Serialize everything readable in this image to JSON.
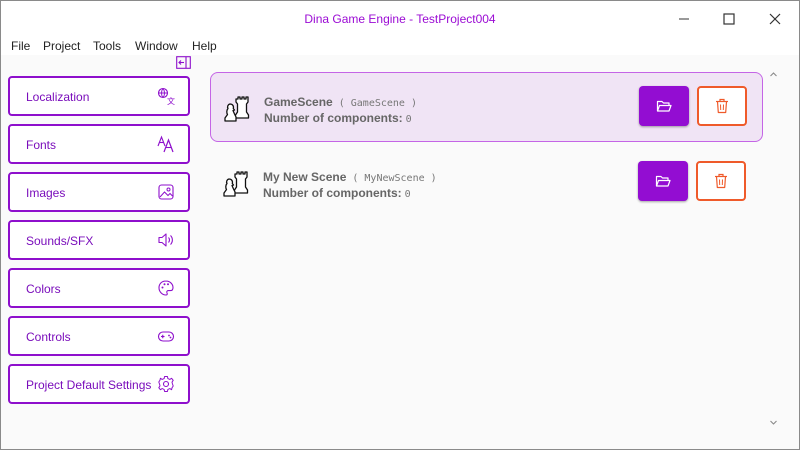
{
  "window": {
    "title": "Dina Game Engine - TestProject004"
  },
  "menu": [
    "File",
    "Project",
    "Tools",
    "Window",
    "Help"
  ],
  "sidebar": {
    "items": [
      {
        "label": "Localization",
        "icon": "translate-icon"
      },
      {
        "label": "Fonts",
        "icon": "font-size-icon"
      },
      {
        "label": "Images",
        "icon": "image-icon"
      },
      {
        "label": "Sounds/SFX",
        "icon": "speaker-icon"
      },
      {
        "label": "Colors",
        "icon": "palette-icon"
      },
      {
        "label": "Controls",
        "icon": "gamepad-icon"
      },
      {
        "label": "Project Default Settings",
        "icon": "gear-icon"
      }
    ]
  },
  "scenes": [
    {
      "name": "GameScene",
      "id": "( GameScene )",
      "components_label": "Number of components:",
      "components": "0",
      "selected": true
    },
    {
      "name": "My New Scene",
      "id": "( MyNewScene )",
      "components_label": "Number of components:",
      "components": "0",
      "selected": false
    }
  ],
  "colors": {
    "accent": "#930dd2",
    "danger": "#ef5a2a",
    "selected_row": "#f0e4f5"
  }
}
